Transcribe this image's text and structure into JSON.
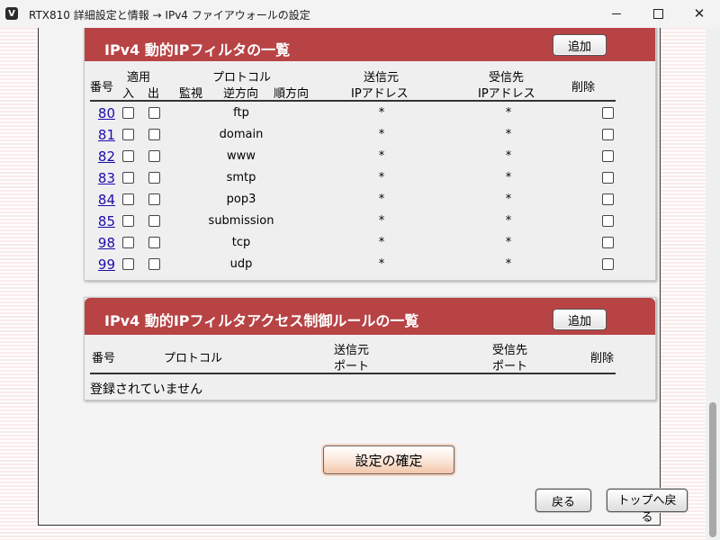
{
  "window": {
    "title": "RTX810 詳細設定と情報 → IPv4 ファイアウォールの設定",
    "min_icon": "minimize-icon",
    "max_icon": "maximize-icon",
    "close_icon": "close-icon"
  },
  "filter_list": {
    "title": "IPv4 動的IPフィルタの一覧",
    "add_label": "追加",
    "headers": {
      "number": "番号",
      "apply": "適用",
      "in": "入",
      "out": "出",
      "protocol": "プロトコル",
      "monitor": "監視",
      "reverse": "逆方向",
      "forward": "順方向",
      "src_line1": "送信元",
      "src_line2": "IPアドレス",
      "dst_line1": "受信先",
      "dst_line2": "IPアドレス",
      "delete": "削除"
    },
    "rows": [
      {
        "num": "80",
        "protocol": "ftp",
        "src": "*",
        "dst": "*"
      },
      {
        "num": "81",
        "protocol": "domain",
        "src": "*",
        "dst": "*"
      },
      {
        "num": "82",
        "protocol": "www",
        "src": "*",
        "dst": "*"
      },
      {
        "num": "83",
        "protocol": "smtp",
        "src": "*",
        "dst": "*"
      },
      {
        "num": "84",
        "protocol": "pop3",
        "src": "*",
        "dst": "*"
      },
      {
        "num": "85",
        "protocol": "submission",
        "src": "*",
        "dst": "*"
      },
      {
        "num": "98",
        "protocol": "tcp",
        "src": "*",
        "dst": "*"
      },
      {
        "num": "99",
        "protocol": "udp",
        "src": "*",
        "dst": "*"
      }
    ]
  },
  "access_list": {
    "title": "IPv4 動的IPフィルタアクセス制御ルールの一覧",
    "add_label": "追加",
    "headers": {
      "number": "番号",
      "protocol": "プロトコル",
      "src_line1": "送信元",
      "src_line2": "ポート",
      "dst_line1": "受信先",
      "dst_line2": "ポート",
      "delete": "削除"
    },
    "empty_message": "登録されていません"
  },
  "buttons": {
    "confirm": "設定の確定",
    "back": "戻る",
    "top": "トップへ戻る"
  }
}
